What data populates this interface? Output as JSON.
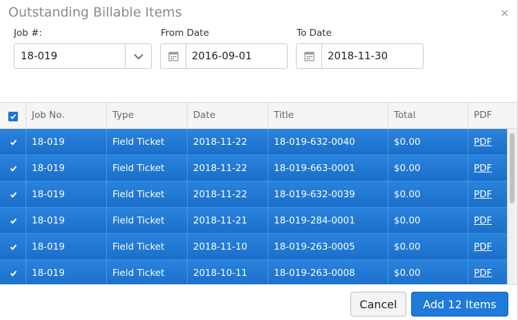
{
  "dialog": {
    "title": "Outstanding Billable Items",
    "close_symbol": "×"
  },
  "filters": {
    "job_label": "Job #:",
    "job_value": "18-019",
    "from_label": "From Date",
    "from_value": "2016-09-01",
    "to_label": "To Date",
    "to_value": "2018-11-30"
  },
  "grid": {
    "headers": [
      "Job No.",
      "Type",
      "Date",
      "Title",
      "Total",
      "PDF"
    ],
    "rows": [
      {
        "job": "18-019",
        "type": "Field Ticket",
        "date": "2018-11-22",
        "title": "18-019-632-0040",
        "total": "$0.00",
        "pdf": "PDF"
      },
      {
        "job": "18-019",
        "type": "Field Ticket",
        "date": "2018-11-22",
        "title": "18-019-663-0001",
        "total": "$0.00",
        "pdf": "PDF"
      },
      {
        "job": "18-019",
        "type": "Field Ticket",
        "date": "2018-11-22",
        "title": "18-019-632-0039",
        "total": "$0.00",
        "pdf": "PDF"
      },
      {
        "job": "18-019",
        "type": "Field Ticket",
        "date": "2018-11-21",
        "title": "18-019-284-0001",
        "total": "$0.00",
        "pdf": "PDF"
      },
      {
        "job": "18-019",
        "type": "Field Ticket",
        "date": "2018-11-10",
        "title": "18-019-263-0005",
        "total": "$0.00",
        "pdf": "PDF"
      },
      {
        "job": "18-019",
        "type": "Field Ticket",
        "date": "2018-10-11",
        "title": "18-019-263-0008",
        "total": "$0.00",
        "pdf": "PDF"
      }
    ]
  },
  "footer": {
    "cancel_label": "Cancel",
    "add_label": "Add 12 Items"
  },
  "colors": {
    "selection": "#1f7ad9",
    "accent": "#1f7ad9"
  }
}
